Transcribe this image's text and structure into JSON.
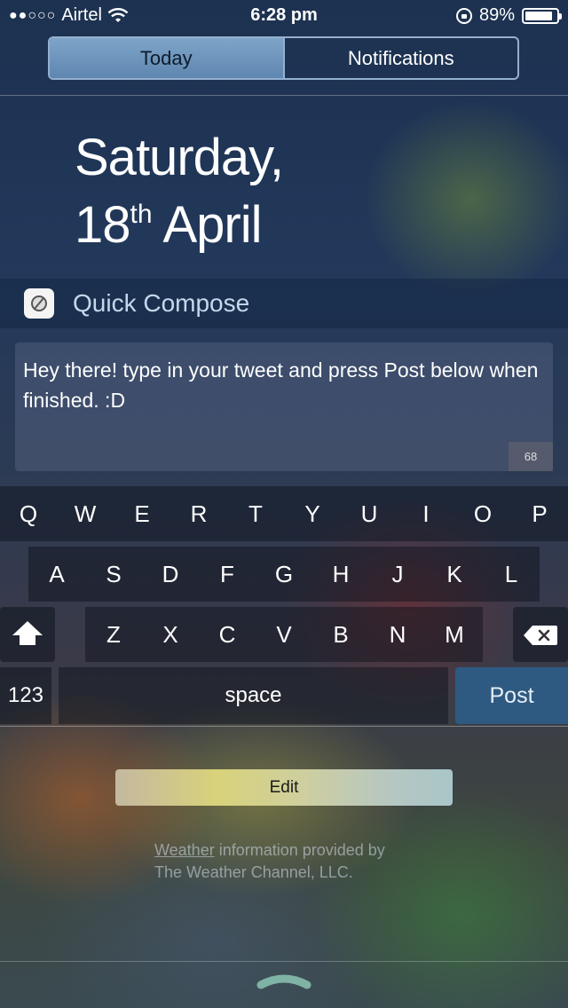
{
  "status_bar": {
    "signal_dots": "●●○○○",
    "carrier": "Airtel",
    "time": "6:28 pm",
    "battery_percent": "89%",
    "battery_level": 0.89
  },
  "tabs": [
    {
      "label": "Today",
      "active": true
    },
    {
      "label": "Notifications",
      "active": false
    }
  ],
  "date": {
    "line1": "Saturday,",
    "day_number": "18",
    "day_suffix": "th",
    "month": "April"
  },
  "widget": {
    "title": "Quick Compose",
    "compose_text": "Hey there! type in your tweet and press Post below when finished. :D",
    "char_count": "68"
  },
  "keyboard": {
    "row1": [
      "Q",
      "W",
      "E",
      "R",
      "T",
      "Y",
      "U",
      "I",
      "O",
      "P"
    ],
    "row2": [
      "A",
      "S",
      "D",
      "F",
      "G",
      "H",
      "J",
      "K",
      "L"
    ],
    "row3": [
      "Z",
      "X",
      "C",
      "V",
      "B",
      "N",
      "M"
    ],
    "numbers_key": "123",
    "space_key": "space",
    "post_key": "Post"
  },
  "edit_button": "Edit",
  "attribution": {
    "link_text": "Weather",
    "text_line1_rest": " information provided by",
    "text_line2": "The Weather Channel, LLC."
  },
  "colors": {
    "post_key_bg": "#2e5a82",
    "active_tab_bg": "#7ea4c8"
  }
}
